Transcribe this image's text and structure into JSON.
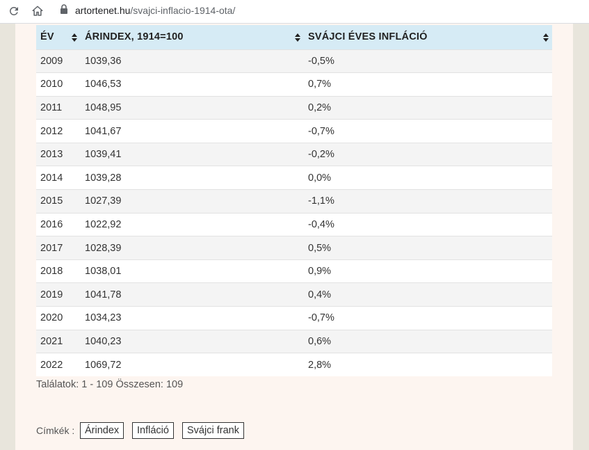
{
  "browser": {
    "domain": "artortenet.hu",
    "path": "/svajci-inflacio-1914-ota/"
  },
  "table": {
    "headers": [
      "ÉV",
      "ÁRINDEX, 1914=100",
      "SVÁJCI ÉVES INFLÁCIÓ"
    ],
    "rows": [
      [
        "2009",
        "1039,36",
        "-0,5%"
      ],
      [
        "2010",
        "1046,53",
        "0,7%"
      ],
      [
        "2011",
        "1048,95",
        "0,2%"
      ],
      [
        "2012",
        "1041,67",
        "-0,7%"
      ],
      [
        "2013",
        "1039,41",
        "-0,2%"
      ],
      [
        "2014",
        "1039,28",
        "0,0%"
      ],
      [
        "2015",
        "1027,39",
        "-1,1%"
      ],
      [
        "2016",
        "1022,92",
        "-0,4%"
      ],
      [
        "2017",
        "1028,39",
        "0,5%"
      ],
      [
        "2018",
        "1038,01",
        "0,9%"
      ],
      [
        "2019",
        "1041,78",
        "0,4%"
      ],
      [
        "2020",
        "1034,23",
        "-0,7%"
      ],
      [
        "2021",
        "1040,23",
        "0,6%"
      ],
      [
        "2022",
        "1069,72",
        "2,8%"
      ]
    ]
  },
  "results_text": "Találatok: 1 - 109 Összesen: 109",
  "tags": {
    "label": "Címkék :",
    "items": [
      "Árindex",
      "Infláció",
      "Svájci frank"
    ]
  }
}
